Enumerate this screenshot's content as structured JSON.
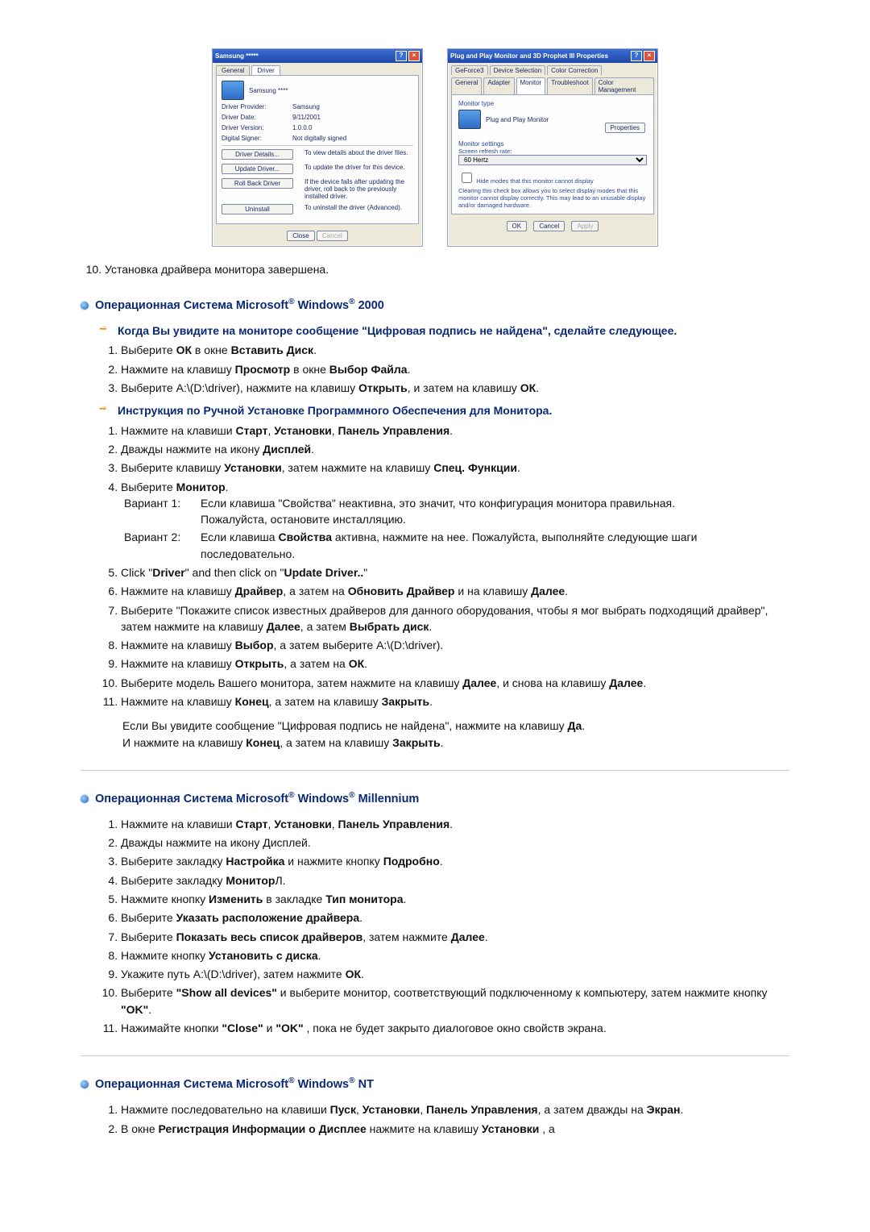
{
  "screenshots": {
    "left": {
      "title": "Samsung *****",
      "tabs": [
        "General",
        "Driver"
      ],
      "device_name": "Samsung ****",
      "fields": {
        "provider_k": "Driver Provider:",
        "provider_v": "Samsung",
        "date_k": "Driver Date:",
        "date_v": "9/11/2001",
        "version_k": "Driver Version:",
        "version_v": "1.0.0.0",
        "signer_k": "Digital Signer:",
        "signer_v": "Not digitally signed"
      },
      "buttons": {
        "details": "Driver Details...",
        "details_d": "To view details about the driver files.",
        "update": "Update Driver...",
        "update_d": "To update the driver for this device.",
        "rollback": "Roll Back Driver",
        "rollback_d": "If the device fails after updating the driver, roll back to the previously installed driver.",
        "uninstall": "Uninstall",
        "uninstall_d": "To uninstall the driver (Advanced)."
      },
      "foot": {
        "close": "Close",
        "cancel": "Cancel"
      }
    },
    "right": {
      "title": "Plug and Play Monitor and 3D Prophet III Properties",
      "tabs_row1": [
        "GeForce3",
        "Device Selection",
        "Color Correction"
      ],
      "tabs_row2": [
        "General",
        "Adapter",
        "Monitor",
        "Troubleshoot",
        "Color Management"
      ],
      "monitor_type_h": "Monitor type",
      "monitor_type_v": "Plug and Play Monitor",
      "properties_btn": "Properties",
      "settings_h": "Monitor settings",
      "refresh_l": "Screen refresh rate:",
      "refresh_v": "60 Hertz",
      "hide_cb": "Hide modes that this monitor cannot display",
      "hide_desc": "Clearing this check box allows you to select display modes that this monitor cannot display correctly. This may lead to an unusable display and/or damaged hardware.",
      "foot": {
        "ok": "OK",
        "cancel": "Cancel",
        "apply": "Apply"
      }
    }
  },
  "top_done": "Установка драйвера монитора завершена.",
  "w2000": {
    "heading_pre": "Операционная Система Microsoft",
    "heading_win": " Windows",
    "heading_suf": " 2000",
    "sub1": "Когда Вы увидите на мониторе сообщение \"Цифровая подпись не найдена\", сделайте следующее.",
    "s1": [
      {
        "pre": "Выберите ",
        "b": "ОК",
        "mid": " в окне ",
        "b2": "Вставить Диск",
        "suf": "."
      },
      {
        "pre": "Нажмите на клавишу ",
        "b": "Просмотр",
        "mid": " в окне ",
        "b2": "Выбор Файла",
        "suf": "."
      },
      {
        "pre": "Выберите A:\\(D:\\driver), нажмите на клавишу ",
        "b": "Открыть",
        "mid": ", и затем на клавишу ",
        "b2": "ОК",
        "suf": "."
      }
    ],
    "sub2": "Инструкция по Ручной Установке Программного Обеспечения для Монитора.",
    "s2_1": {
      "pre": "Нажмите на клавиши ",
      "b": "Старт",
      "b2": "Установки",
      "b3": "Панель Управления",
      "suf": "."
    },
    "s2_2": {
      "pre": "Дважды нажмите на икону ",
      "b": "Дисплей",
      "suf": "."
    },
    "s2_3": {
      "pre": "Выберите клавишу ",
      "b": "Установки",
      "mid": ", затем нажмите на клавишу ",
      "b2": "Спец. Функции",
      "suf": "."
    },
    "s2_4": {
      "pre": "Выберите ",
      "b": "Монитор",
      "suf": "."
    },
    "var1_l": "Вариант 1:",
    "var1_t1": "Если клавиша \"Свойства\" неактивна, это значит, что конфигурация монитора правильная.",
    "var1_t2": "Пожалуйста, остановите инсталляцию.",
    "var2_l": "Вариант 2:",
    "var2_t1_pre": "Если клавиша ",
    "var2_t1_b": "Свойства",
    "var2_t1_suf": " активна, нажмите на нее. Пожалуйста, выполняйте следующие шаги последовательно.",
    "s2_5": {
      "pre": "Click \"",
      "b": "Driver",
      "mid": "\" and then click on \"",
      "b2": "Update Driver..",
      "suf": "\""
    },
    "s2_6": {
      "pre": "Нажмите на клавишу ",
      "b": "Драйвер",
      "mid": ", а затем на ",
      "b2": "Обновить Драйвер",
      "mid2": " и на клавишу ",
      "b3": "Далее",
      "suf": "."
    },
    "s2_7": {
      "pre": "Выберите \"Покажите список известных драйверов для данного оборудования, чтобы я мог выбрать подходящий драйвер\", затем нажмите на клавишу ",
      "b": "Далее",
      "mid": ", а затем ",
      "b2": "Выбрать диск",
      "suf": "."
    },
    "s2_8": {
      "pre": "Нажмите на клавишу ",
      "b": "Выбор",
      "suf": ", а затем выберите A:\\(D:\\driver)."
    },
    "s2_9": {
      "pre": "Нажмите на клавишу ",
      "b": "Открыть",
      "mid": ", а затем на ",
      "b2": "ОК",
      "suf": "."
    },
    "s2_10": {
      "pre": "Выберите модель Вашего монитора, затем нажмите на клавишу ",
      "b": "Далее",
      "mid": ", и снова на клавишу ",
      "b2": "Далее",
      "suf": "."
    },
    "s2_11": {
      "pre": "Нажмите на клавишу ",
      "b": "Конец",
      "mid": ", а затем на клавишу ",
      "b2": "Закрыть",
      "suf": "."
    },
    "note1_pre": "Если Вы увидите сообщение \"Цифровая подпись не найдена\", нажмите на клавишу ",
    "note1_b": "Да",
    "note1_suf": ".",
    "note2_pre": "И нажмите на клавишу ",
    "note2_b": "Конец",
    "note2_mid": ", а затем на клавишу ",
    "note2_b2": "Закрыть",
    "note2_suf": "."
  },
  "wme": {
    "heading_pre": "Операционная Система Microsoft",
    "heading_win": " Windows",
    "heading_suf": " Millennium",
    "s": [
      {
        "pre": "Нажмите на клавиши ",
        "b": "Старт",
        "b2": "Установки",
        "b3": "Панель Управления",
        "suf": "."
      },
      {
        "pre": "Дважды нажмите на икону Дисплей."
      },
      {
        "pre": "Выберите закладку ",
        "b": "Настройка",
        "mid": " и нажмите кнопку ",
        "b2": "Подробно",
        "suf": "."
      },
      {
        "pre": "Выберите закладку ",
        "b": "Монитор",
        "suf": "Л."
      },
      {
        "pre": "Нажмите кнопку ",
        "b": "Изменить",
        "mid": " в закладке ",
        "b2": "Тип монитора",
        "suf": "."
      },
      {
        "pre": "Выберите ",
        "b": "Указать расположение драйвера",
        "suf": "."
      },
      {
        "pre": "Выберите ",
        "b": "Показать весь список драйверов",
        "mid": ", затем нажмите ",
        "b2": "Далее",
        "suf": "."
      },
      {
        "pre": "Нажмите кнопку ",
        "b": "Установить с диска",
        "suf": "."
      },
      {
        "pre": "Укажите путь A:\\(D:\\driver), затем нажмите ",
        "b": "ОК",
        "suf": "."
      },
      {
        "pre": "Выберите ",
        "b": "\"Show all devices\"",
        "mid": " и выберите монитор, соответствующий подключенному к компьютеру, затем нажмите кнопку ",
        "b2": "\"OK\"",
        "suf": "."
      },
      {
        "pre": "Нажимайте кнопки ",
        "b": "\"Close\"",
        "mid": " и ",
        "b2": "\"OK\"",
        "suf": " , пока не будет закрыто диалоговое окно свойств экрана."
      }
    ]
  },
  "wnt": {
    "heading_pre": "Операционная Система Microsoft",
    "heading_win": " Windows",
    "heading_suf": " NT",
    "s1": {
      "pre": "Нажмите последовательно на клавиши ",
      "b": "Пуск",
      "b2": "Установки",
      "b3": "Панель Управления",
      "mid": ", а затем дважды на ",
      "b4": "Экран",
      "suf": "."
    },
    "s2": {
      "pre": "В окне ",
      "b": "Регистрация Информации о Дисплее",
      "mid": " нажмите на клавишу ",
      "b2": "Установки",
      "suf": " , а"
    }
  }
}
